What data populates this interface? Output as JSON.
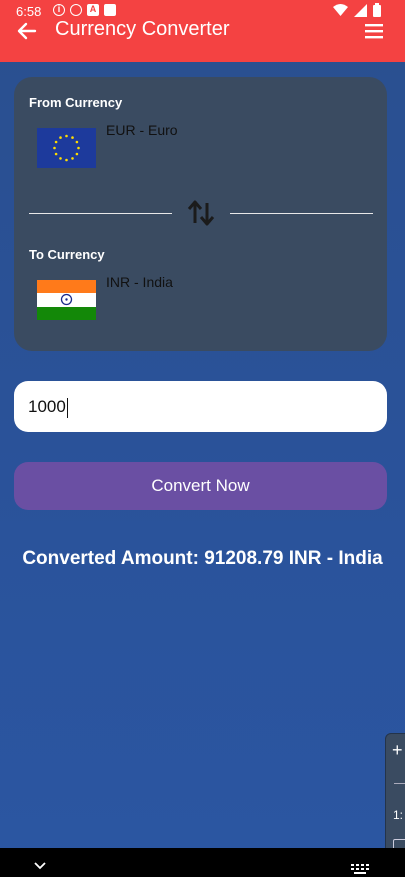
{
  "status_bar": {
    "time": "6:58",
    "left_icons": [
      "info-icon",
      "shield-icon",
      "a-icon",
      "sim-icon"
    ],
    "right_icons": [
      "wifi-icon",
      "signal-icon",
      "battery-icon"
    ]
  },
  "app_bar": {
    "title": "Currency Converter",
    "back_icon": "arrow-left-icon",
    "menu_icon": "hamburger-menu-icon",
    "color": "#f44242"
  },
  "from_currency": {
    "label": "From Currency",
    "code_name": "EUR - Euro",
    "flag": "eu-flag"
  },
  "swap_icon": "swap-vertical-icon",
  "to_currency": {
    "label": "To Currency",
    "code_name": "INR - India",
    "flag": "india-flag"
  },
  "amount_input": {
    "value": "1000"
  },
  "convert_button": {
    "label": "Convert Now",
    "color": "#6a4fa3"
  },
  "result": {
    "text": "Converted Amount: 91208.79 INR - India"
  },
  "side_controls": {
    "zoom_label": "1:"
  }
}
